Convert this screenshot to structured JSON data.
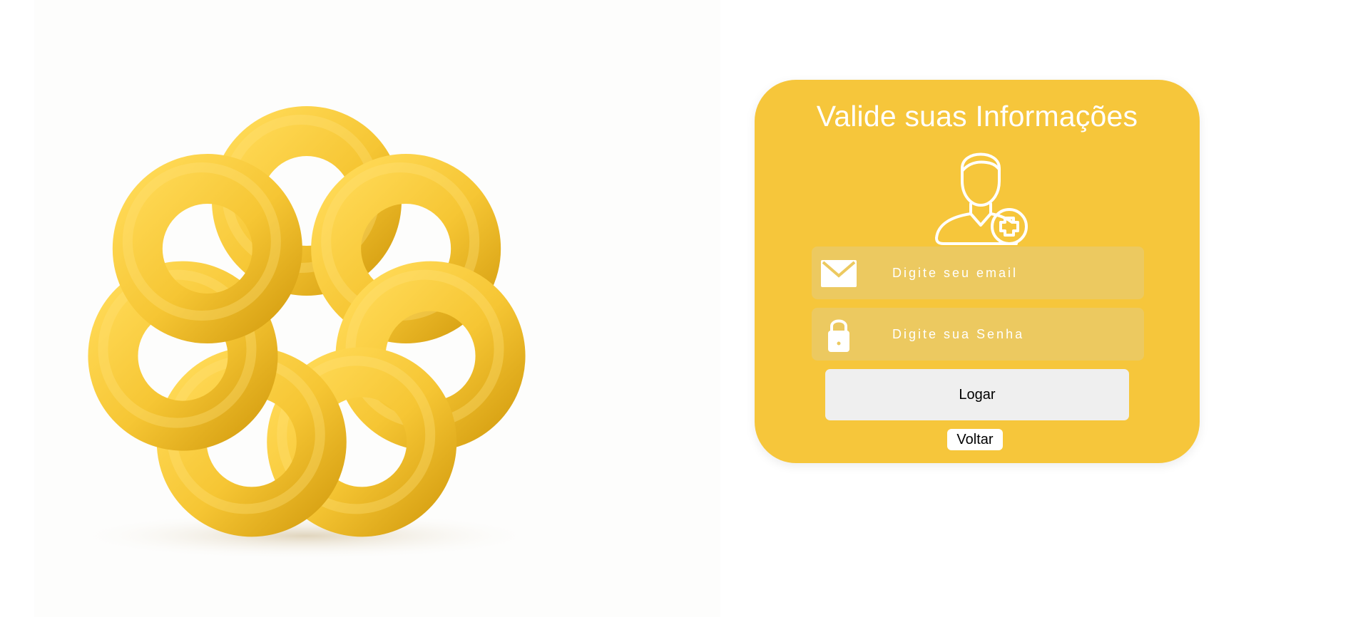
{
  "hero": {
    "image_label": "yellow-torus-flower-3d-illustration",
    "accent_color": "#f3c42c"
  },
  "login_card": {
    "title": "Valide suas Informações",
    "background_color": "#f6c63b",
    "avatar_icon": "user-medical-plus-icon",
    "email_field": {
      "icon": "envelope-icon",
      "placeholder": "Digite seu email"
    },
    "password_field": {
      "icon": "lock-icon",
      "placeholder": "Digite sua Senha"
    },
    "login_button": "Logar",
    "back_button": "Voltar"
  }
}
